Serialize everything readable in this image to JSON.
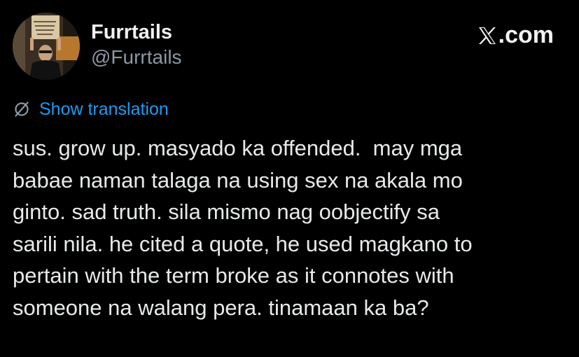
{
  "header": {
    "display_name": "Furrtails",
    "handle": "@Furrtails",
    "brand": ".com"
  },
  "icons": {
    "avatar": "profile-photo",
    "brand": "x-logo-icon",
    "translate": "globe-slash-icon"
  },
  "translation": {
    "label": "Show translation"
  },
  "tweet": {
    "lines": [
      "sus. grow up. masyado ka offended.  may mga",
      "babae naman talaga na using sex na akala mo",
      "ginto. sad truth. sila mismo nag oobjectify sa",
      "sarili nila. he cited a quote, he used magkano to",
      "pertain with the term broke as it connotes with",
      "someone na walang pera. tinamaan ka ba?"
    ]
  },
  "colors": {
    "background": "#000000",
    "text": "#e7e9ea",
    "muted": "#8b98a5",
    "link": "#1d9bf0"
  }
}
